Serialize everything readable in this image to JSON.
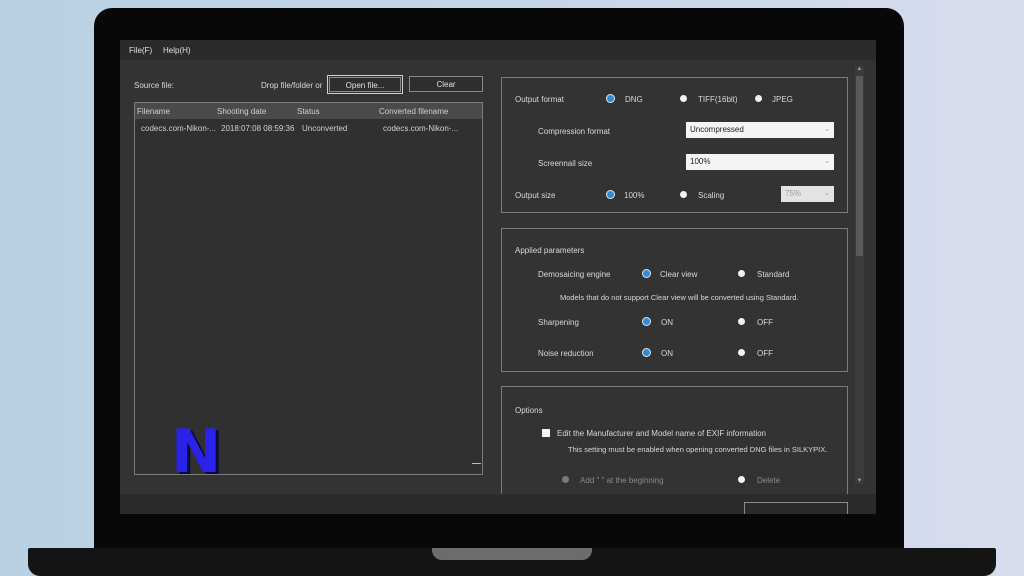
{
  "menu": {
    "file": "File(F)",
    "help": "Help(H)"
  },
  "source": {
    "label": "Source file:",
    "drop_text": "Drop file/folder or",
    "open_button": "Open file...",
    "clear_button": "Clear"
  },
  "list": {
    "columns": [
      "Filename",
      "Shooting date",
      "Status",
      "Converted filename"
    ],
    "rows": [
      {
        "filename": "codecs.com-Nikon-...",
        "date": "2018:07:08 08:59:36",
        "status": "Unconverted",
        "converted": "codecs.com-Nikon-..."
      }
    ]
  },
  "output": {
    "format_label": "Output format",
    "formats": [
      "DNG",
      "TIFF(16bit)",
      "JPEG"
    ],
    "selected_format": "DNG",
    "compression_label": "Compression format",
    "compression_value": "Uncompressed",
    "screennail_label": "Screennail size",
    "screennail_value": "100%",
    "size_label": "Output size",
    "size_options": [
      "100%",
      "Scaling"
    ],
    "selected_size": "100%",
    "scaling_value": "75%"
  },
  "params": {
    "title": "Applied parameters",
    "demosaic_label": "Demosaicing engine",
    "demosaic_options": [
      "Clear view",
      "Standard"
    ],
    "demosaic_selected": "Clear view",
    "demosaic_note": "Models that do not support Clear view will be converted using Standard.",
    "sharpening_label": "Sharpening",
    "sharpening_options": [
      "ON",
      "OFF"
    ],
    "sharpening_selected": "ON",
    "noise_label": "Noise reduction",
    "noise_options": [
      "ON",
      "OFF"
    ],
    "noise_selected": "ON"
  },
  "options": {
    "title": "Options",
    "exif_checkbox": "Edit the Manufacturer and Model name of EXIF information",
    "exif_note": "This setting must be enabled when opening converted DNG files in SILKYPIX.",
    "add_option": "Add \" \" at the beginning",
    "delete_option": "Delete"
  },
  "logo": {
    "text": "N",
    "color": "#2a22e8"
  },
  "colors": {
    "window_bg": "#333333",
    "accent": "#2e8ad8",
    "panel_border": "#7c7c7c"
  }
}
